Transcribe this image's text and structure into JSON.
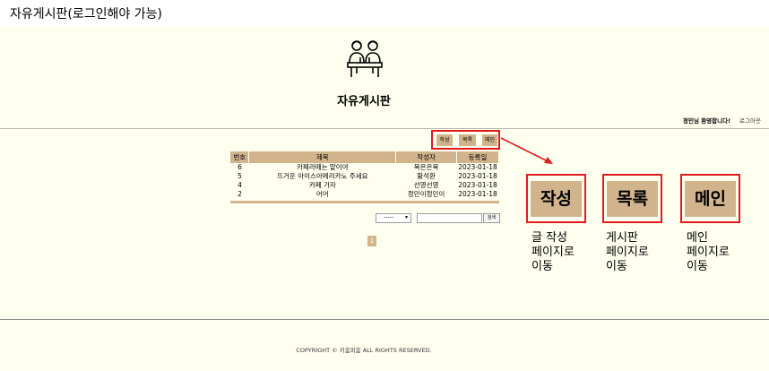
{
  "caption": "자유게시판(로그인해야 가능)",
  "board_title": "자유게시판",
  "header": {
    "welcome": "정민님 환영합니다!",
    "logout": "로그아웃"
  },
  "actions": {
    "write": "작성",
    "list": "목록",
    "main": "메인"
  },
  "table": {
    "columns": [
      "번호",
      "제목",
      "작성자",
      "등록일"
    ],
    "rows": [
      {
        "num": "6",
        "title": "카페라떼는 맡이야",
        "author": "목은은목",
        "date": "2023-01-18"
      },
      {
        "num": "5",
        "title": "뜨거운 아이스아메리카노 주세요",
        "author": "황석환",
        "date": "2023-01-18"
      },
      {
        "num": "4",
        "title": "카페 가자",
        "author": "선영선영",
        "date": "2023-01-18"
      },
      {
        "num": "2",
        "title": "어어",
        "author": "정민이정민이",
        "date": "2023-01-18"
      }
    ]
  },
  "search": {
    "select_value": "-----",
    "input_value": "",
    "button": "검색"
  },
  "pagination": [
    "1"
  ],
  "annotations": {
    "write_desc": "글 작성\n페이지로\n이동",
    "list_desc": "게시판\n페이지로\n이동",
    "main_desc": "메인\n페이지로\n이동"
  },
  "footer": {
    "copyright": "COPYRIGHT © 키움피움 ALL RIGHTS RESERVED."
  },
  "colors": {
    "background": "#fffff0",
    "accent": "#d2b48c",
    "highlight": "#e31b1b"
  }
}
